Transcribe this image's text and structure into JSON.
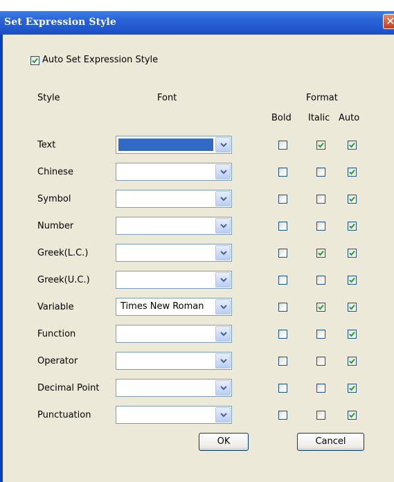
{
  "window": {
    "title": "Set Expression Style",
    "close_glyph": "✕"
  },
  "auto_set": {
    "label": "Auto Set Expression Style",
    "checked": true
  },
  "headers": {
    "style": "Style",
    "font": "Font",
    "format": "Format",
    "bold": "Bold",
    "italic": "Italic",
    "auto": "Auto"
  },
  "rows": [
    {
      "style": "Text",
      "font": "",
      "bold": false,
      "italic": true,
      "auto": true
    },
    {
      "style": "Chinese",
      "font": "",
      "bold": false,
      "italic": false,
      "auto": true
    },
    {
      "style": "Symbol",
      "font": "",
      "bold": false,
      "italic": false,
      "auto": true
    },
    {
      "style": "Number",
      "font": "",
      "bold": false,
      "italic": false,
      "auto": true
    },
    {
      "style": "Greek(L.C.)",
      "font": "",
      "bold": false,
      "italic": true,
      "auto": true
    },
    {
      "style": "Greek(U.C.)",
      "font": "",
      "bold": false,
      "italic": false,
      "auto": true
    },
    {
      "style": "Variable",
      "font": "Times New Roman",
      "bold": false,
      "italic": true,
      "auto": true
    },
    {
      "style": "Function",
      "font": "",
      "bold": false,
      "italic": false,
      "auto": true
    },
    {
      "style": "Operator",
      "font": "",
      "bold": false,
      "italic": false,
      "auto": true
    },
    {
      "style": "Decimal Point",
      "font": "",
      "bold": false,
      "italic": false,
      "auto": true
    },
    {
      "style": "Punctuation",
      "font": "",
      "bold": false,
      "italic": false,
      "auto": true
    }
  ],
  "buttons": {
    "ok": "OK",
    "cancel": "Cancel"
  },
  "colors": {
    "titlebar": "#2a62d6",
    "dialog_bg": "#ece9d8",
    "check_mark": "#21a121",
    "selection": "#316ac5"
  }
}
